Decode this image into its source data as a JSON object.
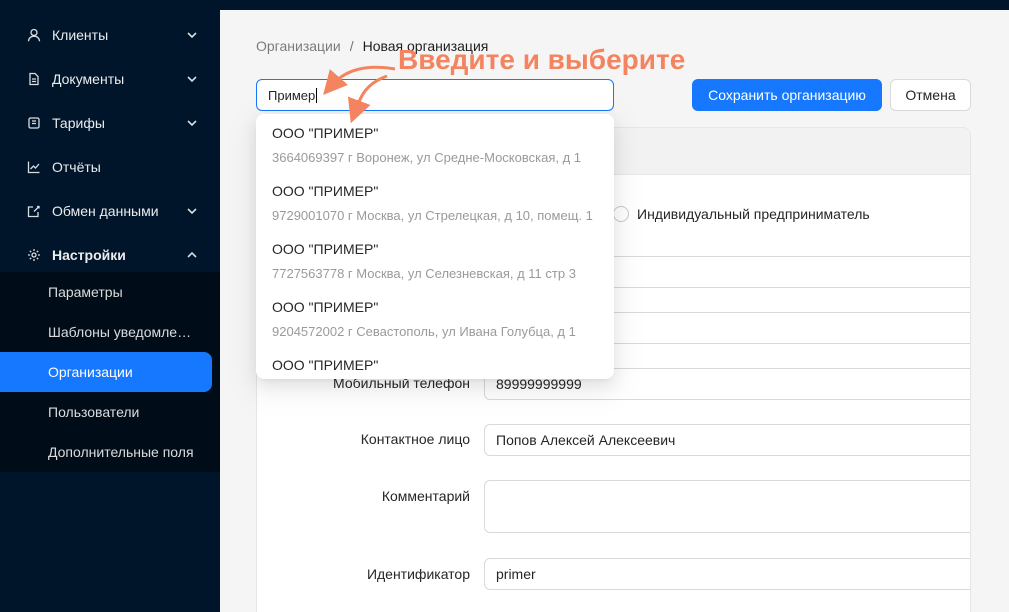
{
  "sidebar": {
    "items": [
      {
        "label": "Клиенты",
        "icon": "user-icon",
        "expandable": true
      },
      {
        "label": "Документы",
        "icon": "document-icon",
        "expandable": true
      },
      {
        "label": "Тарифы",
        "icon": "tag-icon",
        "expandable": true
      },
      {
        "label": "Отчёты",
        "icon": "chart-icon",
        "expandable": false
      },
      {
        "label": "Обмен данными",
        "icon": "edit-icon",
        "expandable": true
      },
      {
        "label": "Настройки",
        "icon": "gear-icon",
        "expandable": true,
        "expanded": true
      }
    ],
    "subitems": [
      {
        "label": "Параметры"
      },
      {
        "label": "Шаблоны уведомлений"
      },
      {
        "label": "Организации",
        "active": true
      },
      {
        "label": "Пользователи"
      },
      {
        "label": "Дополнительные поля"
      }
    ]
  },
  "breadcrumb": {
    "parent": "Организации",
    "separator": "/",
    "current": "Новая организация"
  },
  "search": {
    "value": "Пример"
  },
  "toolbar": {
    "save_label": "Сохранить организацию",
    "cancel_label": "Отмена"
  },
  "dropdown": {
    "options": [
      {
        "name": "ООО \"ПРИМЕР\"",
        "address": "3664069397 г Воронеж, ул Средне-Московская, д 1"
      },
      {
        "name": "ООО \"ПРИМЕР\"",
        "address": "9729001070 г Москва, ул Стрелецкая, д 10, помещ. 1"
      },
      {
        "name": "ООО \"ПРИМЕР\"",
        "address": "7727563778 г Москва, ул Селезневская, д 11 стр 3"
      },
      {
        "name": "ООО \"ПРИМЕР\"",
        "address": "9204572002 г Севастополь, ул Ивана Голубца, д 1"
      },
      {
        "name": "ООО \"ПРИМЕР\"",
        "address": ""
      }
    ]
  },
  "form": {
    "radio_ip_label": "Индивидуальный предприниматель",
    "mobile_label": "Мобильный телефон",
    "mobile_value": "89999999999",
    "contact_label": "Контактное лицо",
    "contact_value": "Попов Алексей Алексеевич",
    "comment_label": "Комментарий",
    "identifier_label": "Идентификатор",
    "identifier_value": "primer"
  },
  "annotation": {
    "text": "Введите и выберите",
    "color": "#f4845f"
  },
  "colors": {
    "sidebar_bg": "#001529",
    "submenu_bg": "#000c17",
    "accent": "#1677ff"
  }
}
